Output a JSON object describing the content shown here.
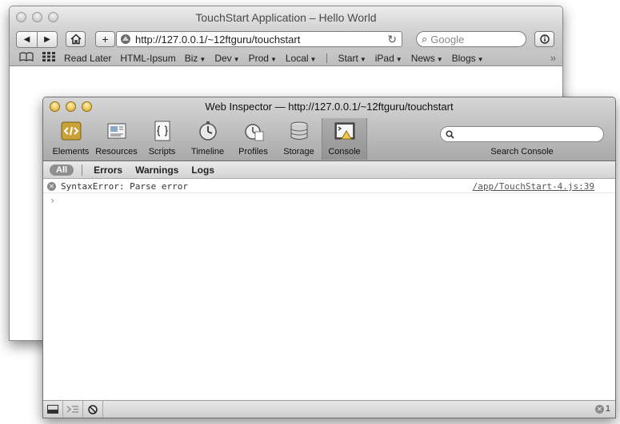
{
  "browser": {
    "title": "TouchStart Application – Hello World",
    "url": "http://127.0.0.1/~12ftguru/touchstart",
    "search_placeholder": "Google",
    "bookmarks": [
      "Read Later",
      "HTML-Ipsum",
      "Biz",
      "Dev",
      "Prod",
      "Local",
      "Start",
      "iPad",
      "News",
      "Blogs"
    ]
  },
  "inspector": {
    "title": "Web Inspector — http://127.0.0.1/~12ftguru/touchstart",
    "panels": [
      "Elements",
      "Resources",
      "Scripts",
      "Timeline",
      "Profiles",
      "Storage",
      "Console"
    ],
    "active_panel": "Console",
    "search_label": "Search Console",
    "filters": {
      "all": "All",
      "errors": "Errors",
      "warnings": "Warnings",
      "logs": "Logs"
    },
    "messages": [
      {
        "text": "SyntaxError: Parse error",
        "source": "/app/TouchStart-4.js:39",
        "level": "error"
      }
    ],
    "prompt": "›",
    "error_count": "1"
  },
  "colors": {
    "inspector_lights": "#d9a21b",
    "browser_lights": "#b9b9b9"
  }
}
